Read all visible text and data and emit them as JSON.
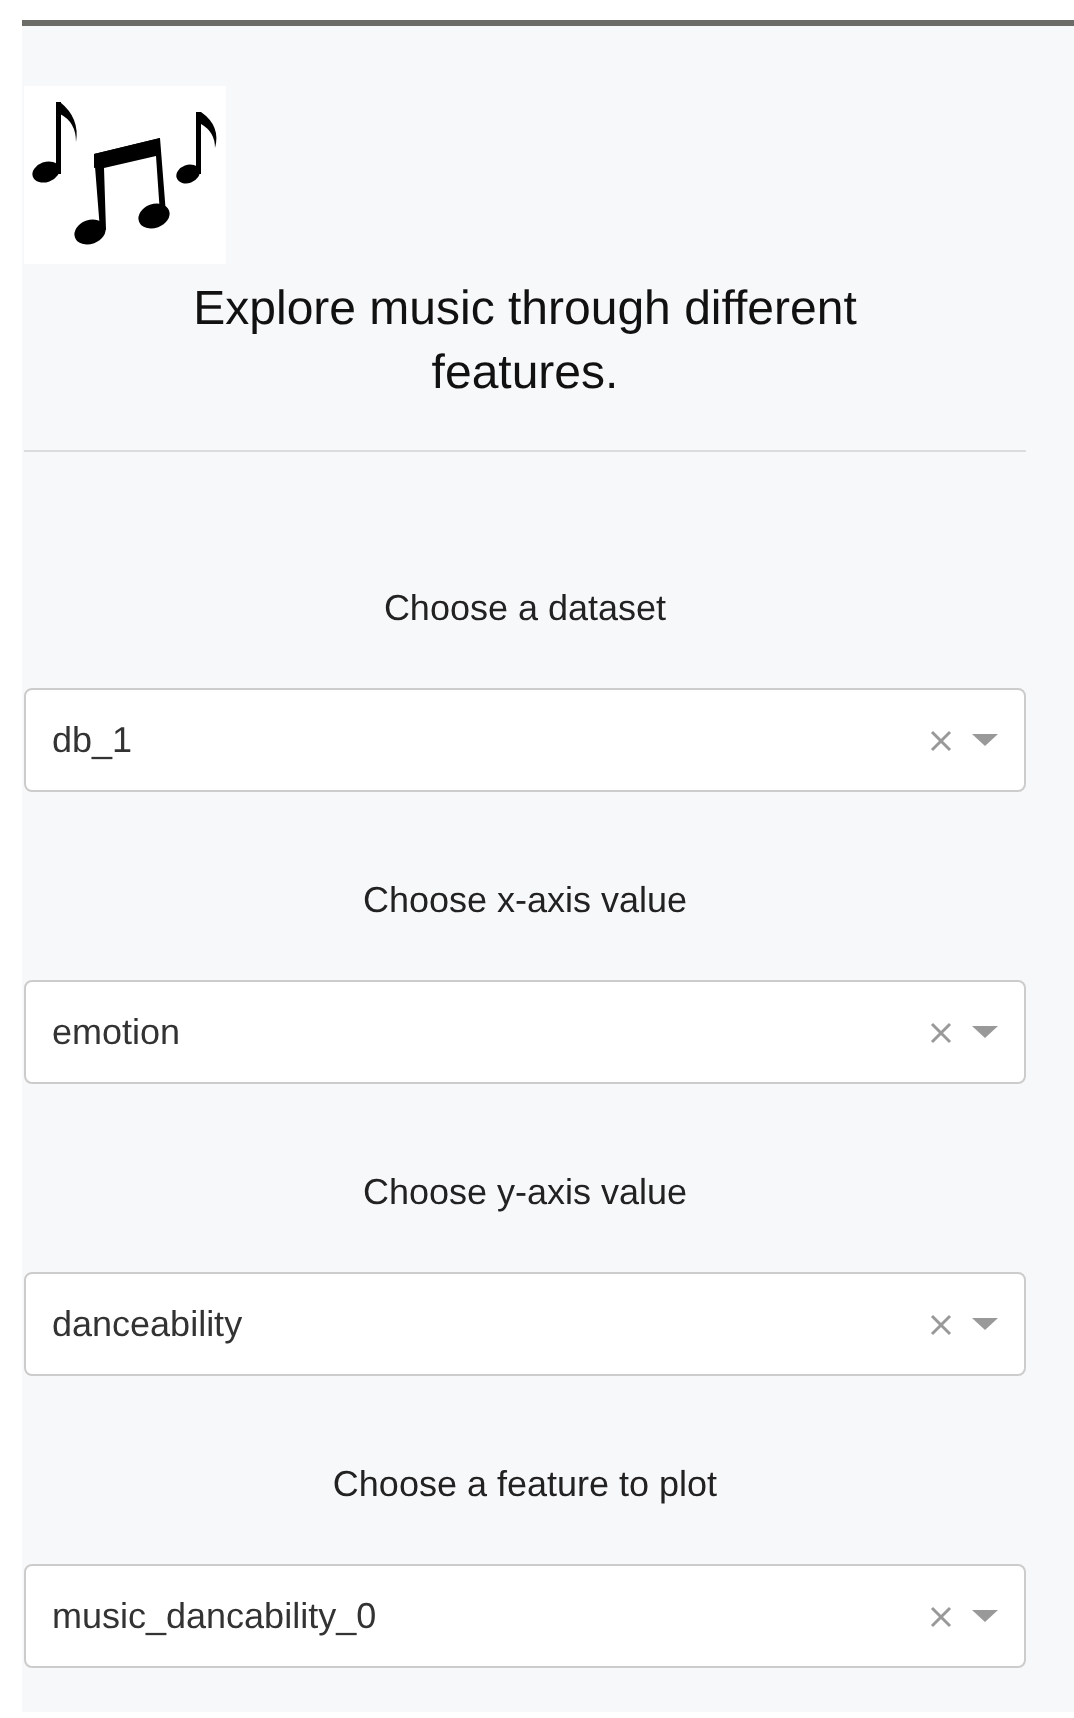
{
  "header": {
    "title": "Explore music through different features."
  },
  "controls": [
    {
      "label": "Choose a dataset",
      "value": "db_1"
    },
    {
      "label": "Choose x-axis value",
      "value": "emotion"
    },
    {
      "label": "Choose y-axis value",
      "value": "danceability"
    },
    {
      "label": "Choose a feature to plot",
      "value": "music_dancability_0"
    }
  ]
}
